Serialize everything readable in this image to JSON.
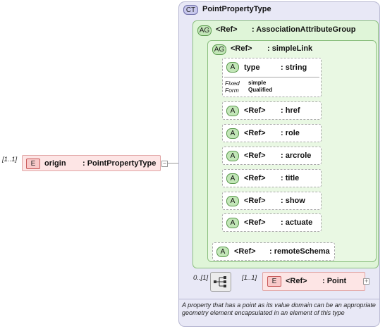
{
  "complex_type": {
    "badge": "CT",
    "name": "PointPropertyType",
    "documentation": "A property that has a point as its value domain can be an appropriate geometry element encapsulated in an element of this type"
  },
  "root_element": {
    "multiplicity": "[1..1]",
    "badge": "E",
    "name": "origin",
    "type": ": PointPropertyType",
    "expander": "−"
  },
  "association_group": {
    "badge": "AG",
    "ref": "<Ref>",
    "name": ": AssociationAttributeGroup"
  },
  "simple_link_group": {
    "badge": "AG",
    "ref": "<Ref>",
    "name": ": simpleLink"
  },
  "type_attribute": {
    "badge": "A",
    "name": "type",
    "type": ": string",
    "fixed_label": "Fixed",
    "fixed_value": "simple",
    "form_label": "Form",
    "form_value": "Qualified"
  },
  "attributes": [
    {
      "badge": "A",
      "ref": "<Ref>",
      "name": ": href"
    },
    {
      "badge": "A",
      "ref": "<Ref>",
      "name": ": role"
    },
    {
      "badge": "A",
      "ref": "<Ref>",
      "name": ": arcrole"
    },
    {
      "badge": "A",
      "ref": "<Ref>",
      "name": ": title"
    },
    {
      "badge": "A",
      "ref": "<Ref>",
      "name": ": show"
    },
    {
      "badge": "A",
      "ref": "<Ref>",
      "name": ": actuate"
    }
  ],
  "remote_schema": {
    "badge": "A",
    "ref": "<Ref>",
    "name": ": remoteSchema"
  },
  "sequence": {
    "multiplicity": "0..[1]"
  },
  "point_element": {
    "multiplicity": "[1..1]",
    "badge": "E",
    "ref": "<Ref>",
    "name": ": Point",
    "expander": "+"
  }
}
